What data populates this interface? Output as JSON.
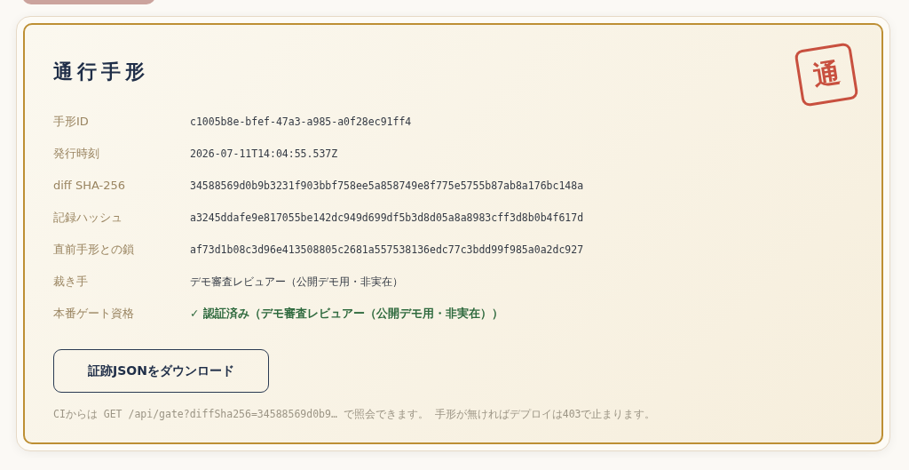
{
  "pass": {
    "title": "通行手形",
    "stamp": "通",
    "fields": [
      {
        "label": "手形ID",
        "value": "c1005b8e-bfef-47a3-a985-a0f28ec91ff4",
        "kind": "mono"
      },
      {
        "label": "発行時刻",
        "value": "2026-07-11T14:04:55.537Z",
        "kind": "mono"
      },
      {
        "label": "diff SHA-256",
        "value": "34588569d0b9b3231f903bbf758ee5a858749e8f775e5755b87ab8a176bc148a",
        "kind": "mono"
      },
      {
        "label": "記録ハッシュ",
        "value": "a3245ddafe9e817055be142dc949d699df5b3d8d05a8a8983cff3d8b0b4f617d",
        "kind": "mono"
      },
      {
        "label": "直前手形との鎖",
        "value": "af73d1b08c3d96e413508805c2681a557538136edc77c3bdd99f985a0a2dc927",
        "kind": "mono"
      },
      {
        "label": "裁き手",
        "value": "デモ審査レビュアー（公開デモ用・非実在）",
        "kind": "text"
      },
      {
        "label": "本番ゲート資格",
        "value": "✓ 認証済み（デモ審査レビュアー（公開デモ用・非実在））",
        "kind": "status",
        "verified": true
      }
    ],
    "download_button": "証跡JSONをダウンロード",
    "footnote": "CIからは GET /api/gate?diffSha256=34588569d0b9… で照会できます。 手形が無ければデプロイは403で止まります。"
  }
}
